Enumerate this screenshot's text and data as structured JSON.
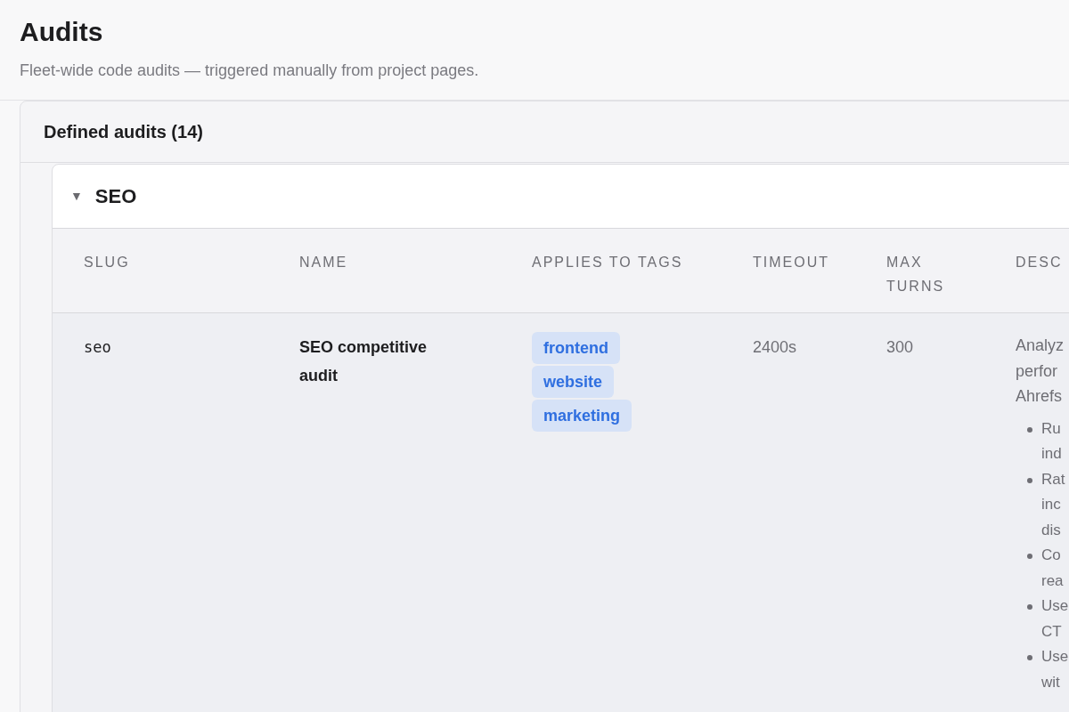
{
  "page": {
    "title": "Audits",
    "subtitle": "Fleet-wide code audits — triggered manually from project pages."
  },
  "panel": {
    "title": "Defined audits (14)"
  },
  "group": {
    "toggle": "▼",
    "title": "SEO",
    "expanded": true
  },
  "table": {
    "columns": [
      "SLUG",
      "NAME",
      "APPLIES TO TAGS",
      "TIMEOUT",
      "MAX TURNS",
      "DESC"
    ],
    "rows": [
      {
        "slug": "seo",
        "name": "SEO competitive audit",
        "tags": [
          "frontend",
          "website",
          "marketing"
        ],
        "timeout": "2400s",
        "max_turns": "300",
        "description": {
          "lines": [
            "Analyz",
            "perfor",
            "Ahrefs"
          ],
          "bullets": [
            [
              "Ru",
              "ind"
            ],
            [
              "Rat",
              "inc",
              "dis"
            ],
            [
              "Co",
              "rea"
            ],
            [
              "Use",
              "CT"
            ],
            [
              "Use",
              "wit"
            ]
          ]
        }
      }
    ]
  }
}
